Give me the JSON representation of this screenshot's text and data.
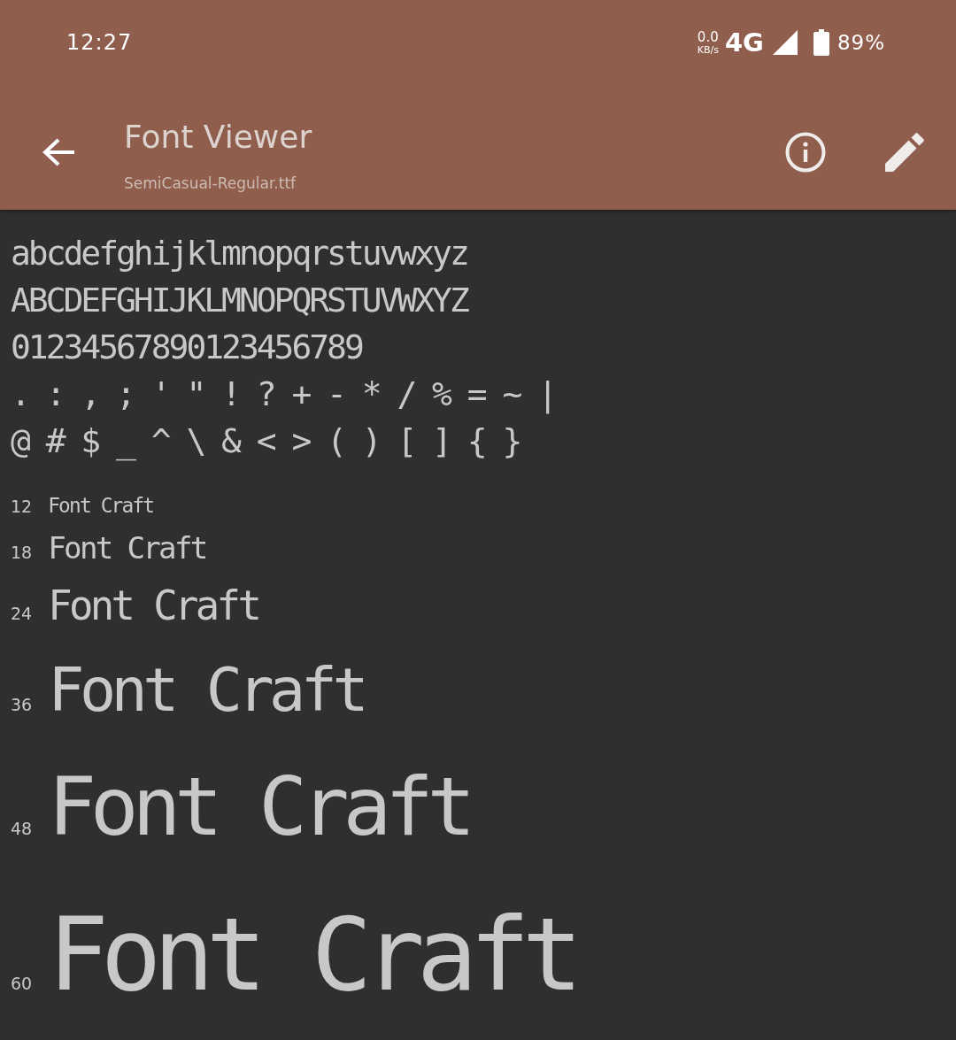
{
  "status_bar": {
    "time": "12:27",
    "net_speed": "0.0",
    "net_speed_unit": "KB/s",
    "network": "4G",
    "battery": "89%"
  },
  "app_bar": {
    "title": "Font Viewer",
    "subtitle": "SemiCasual-Regular.ttf"
  },
  "character_set": [
    "abcdefghijklmnopqrstuvwxyz",
    "ABCDEFGHIJKLMNOPQRSTUVWXYZ",
    "01234567890123456789",
    ". : , ; ' \" ! ? + - * / % = ~ |",
    "@ # $ _ ^ \\ & < > ( ) [ ] { }"
  ],
  "size_samples": [
    {
      "size": "12",
      "text": "Font Craft"
    },
    {
      "size": "18",
      "text": "Font Craft"
    },
    {
      "size": "24",
      "text": "Font Craft"
    },
    {
      "size": "36",
      "text": "Font Craft"
    },
    {
      "size": "48",
      "text": "Font Craft"
    },
    {
      "size": "60",
      "text": "Font Craft"
    }
  ]
}
